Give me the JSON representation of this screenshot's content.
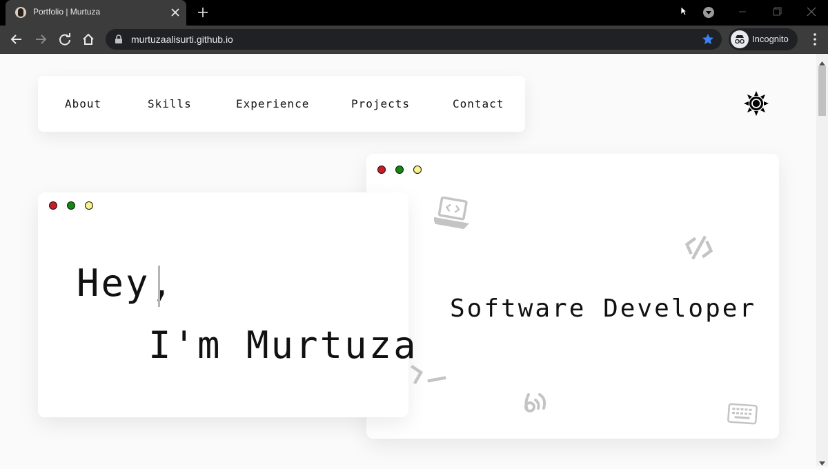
{
  "browser": {
    "tab_title": "Portfolio | Murtuza",
    "url": "murtuzaalisurti.github.io",
    "profile_label": "Incognito",
    "accent_color": "#3b82f6"
  },
  "nav": {
    "items": [
      {
        "label": "About"
      },
      {
        "label": "Skills"
      },
      {
        "label": "Experience"
      },
      {
        "label": "Projects"
      },
      {
        "label": "Contact"
      }
    ]
  },
  "theme_toggle": {
    "icon": "sun-icon"
  },
  "hero": {
    "greeting": "Hey,",
    "name_line": "I'm Murtuza",
    "role": "Software Developer",
    "dot_colors": {
      "red": "#c81d25",
      "green": "#128712",
      "yellow": "#f7f28a"
    },
    "decorative_icons": [
      "laptop-code-icon",
      "code-slash-icon",
      "terminal-prompt-icon",
      "wifi-hand-icon",
      "keyboard-icon"
    ]
  }
}
